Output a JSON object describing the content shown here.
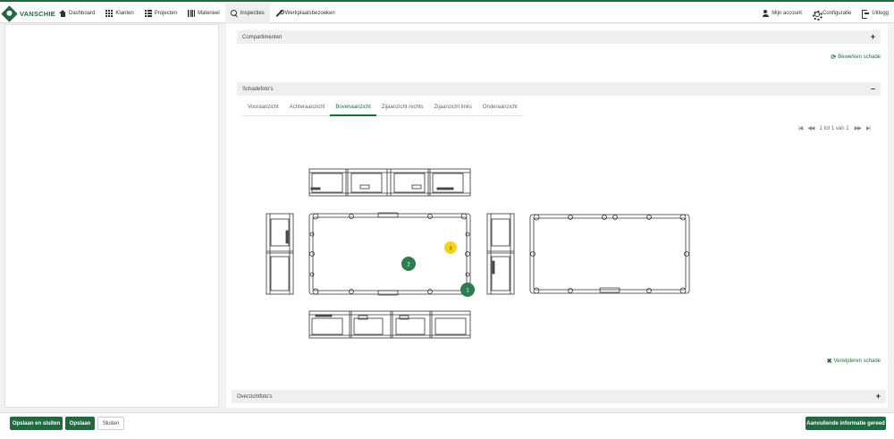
{
  "app": {
    "logo_text": "VANSCHIE",
    "accent_color": "#1f6b3f"
  },
  "nav": {
    "left": [
      {
        "label": "Dashboard",
        "icon": "home-icon"
      },
      {
        "label": "Klanten",
        "icon": "grid-icon"
      },
      {
        "label": "Projecten",
        "icon": "list-icon"
      },
      {
        "label": "Materieel",
        "icon": "bars-icon"
      },
      {
        "label": "Inspecties",
        "icon": "search-icon",
        "active": true
      },
      {
        "label": "Werkplaatsbezoeken",
        "icon": "wrench-icon"
      }
    ],
    "right": [
      {
        "label": "Mijn account",
        "icon": "user-icon"
      },
      {
        "label": "Configuratie",
        "icon": "gear-icon"
      },
      {
        "label": "Uitlogg",
        "icon": "sign-out-icon"
      }
    ]
  },
  "sections": {
    "compartments": {
      "title": "Compartimenten",
      "toggle": "+"
    },
    "edit_damage_link": "Bewerken schade",
    "damage_photos": {
      "title": "Schadefoto's",
      "toggle": "–"
    },
    "overview_photos": {
      "title": "Overzichtfoto's",
      "toggle": "+"
    }
  },
  "tabs": [
    {
      "label": "Vooraanzicht"
    },
    {
      "label": "Achteraanzicht"
    },
    {
      "label": "Bovenaanzicht",
      "active": true
    },
    {
      "label": "Zijaanzicht rechts"
    },
    {
      "label": "Zijaanzicht links"
    },
    {
      "label": "Onderaanzicht"
    }
  ],
  "pager": {
    "text": "1 tot 1 van 1",
    "first": "|◀",
    "prev": "◀◀",
    "next": "▶▶",
    "last": "▶|"
  },
  "damage_markers": [
    {
      "label": "1",
      "color": "#2e7d52"
    },
    {
      "label": "2",
      "color": "#2e7d52"
    },
    {
      "label": "3",
      "color": "#f5d21a"
    }
  ],
  "remove_damage_link": "Verwijderen schade",
  "footer": {
    "save_close": "Opslaan en sluiten",
    "save": "Opslaan",
    "close": "Sluiten",
    "extra_info": "Aanvullende informatie gereed"
  }
}
